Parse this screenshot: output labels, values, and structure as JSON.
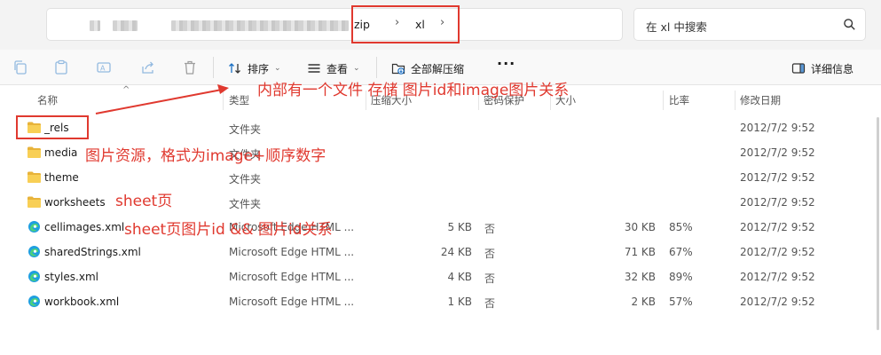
{
  "address": {
    "crumbs": [
      ".zip",
      "xl"
    ],
    "separator": "›",
    "search_placeholder": "在 xl 中搜索"
  },
  "toolbar": {
    "sort_label": "排序",
    "view_label": "查看",
    "extract_label": "全部解压缩",
    "more_label": "···",
    "details_label": "详细信息"
  },
  "columns": {
    "name": "名称",
    "type": "类型",
    "packed_size": "压缩大小",
    "password": "密码保护",
    "size": "大小",
    "ratio": "比率",
    "modified": "修改日期"
  },
  "rows": [
    {
      "name": "_rels",
      "type": "文件夹",
      "packed": "",
      "protected": "",
      "size": "",
      "ratio": "",
      "date": "2012/7/2 9:52",
      "kind": "folder"
    },
    {
      "name": "media",
      "type": "文件夹",
      "packed": "",
      "protected": "",
      "size": "",
      "ratio": "",
      "date": "2012/7/2 9:52",
      "kind": "folder"
    },
    {
      "name": "theme",
      "type": "文件夹",
      "packed": "",
      "protected": "",
      "size": "",
      "ratio": "",
      "date": "2012/7/2 9:52",
      "kind": "folder"
    },
    {
      "name": "worksheets",
      "type": "文件夹",
      "packed": "",
      "protected": "",
      "size": "",
      "ratio": "",
      "date": "2012/7/2 9:52",
      "kind": "folder"
    },
    {
      "name": "cellimages.xml",
      "type": "Microsoft Edge HTML ...",
      "packed": "5 KB",
      "protected": "否",
      "size": "30 KB",
      "ratio": "85%",
      "date": "2012/7/2 9:52",
      "kind": "edge"
    },
    {
      "name": "sharedStrings.xml",
      "type": "Microsoft Edge HTML ...",
      "packed": "24 KB",
      "protected": "否",
      "size": "71 KB",
      "ratio": "67%",
      "date": "2012/7/2 9:52",
      "kind": "edge"
    },
    {
      "name": "styles.xml",
      "type": "Microsoft Edge HTML ...",
      "packed": "4 KB",
      "protected": "否",
      "size": "32 KB",
      "ratio": "89%",
      "date": "2012/7/2 9:52",
      "kind": "edge"
    },
    {
      "name": "workbook.xml",
      "type": "Microsoft Edge HTML ...",
      "packed": "1 KB",
      "protected": "否",
      "size": "2 KB",
      "ratio": "57%",
      "date": "2012/7/2 9:52",
      "kind": "edge"
    }
  ],
  "annotations": {
    "rels_note": "内部有一个文件 存储 图片id和image图片关系",
    "media_note": "图片资源，格式为image+顺序数字",
    "worksheets_note": "sheet页",
    "cellimages_note": "sheet页图片id && 图片id关系"
  },
  "colors": {
    "annotation": "#e0392f",
    "folder": "#f5c542",
    "edge": "#1a8fd6"
  }
}
